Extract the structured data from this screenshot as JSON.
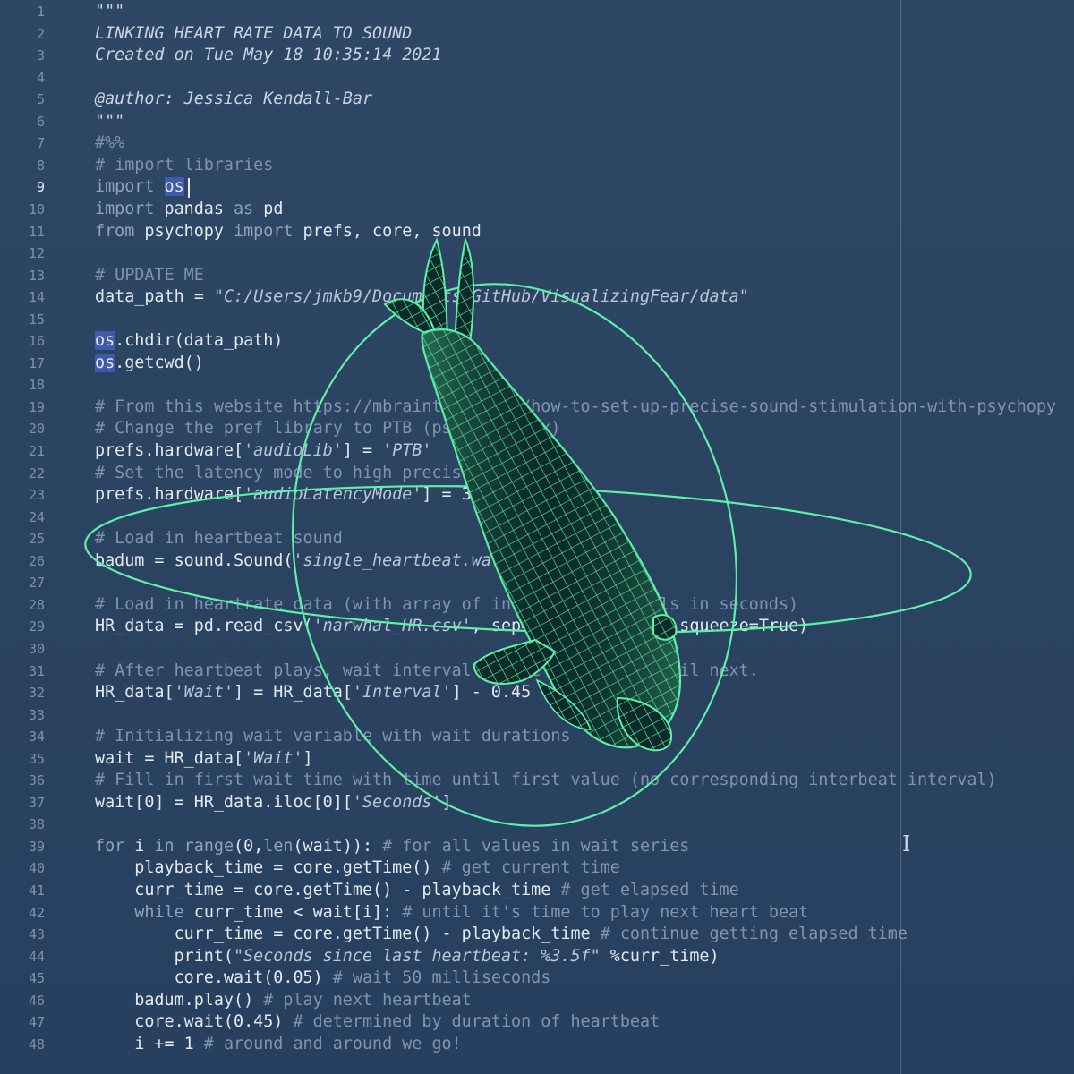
{
  "editor": {
    "active_line": 9,
    "colors": {
      "background": "#2b4461",
      "code_text": "#e3e9f1",
      "comment_text": "#8094ae",
      "selection_highlight": "#506ee6",
      "overlay_accent": "#5ef0a8"
    },
    "lines": [
      {
        "n": "1",
        "tokens": [
          {
            "t": "\"\"\"",
            "k": "d"
          }
        ]
      },
      {
        "n": "2",
        "tokens": [
          {
            "t": "LINKING HEART RATE DATA TO SOUND",
            "k": "d"
          }
        ]
      },
      {
        "n": "3",
        "tokens": [
          {
            "t": "Created on Tue May 18 10:35:14 2021",
            "k": "d"
          }
        ]
      },
      {
        "n": "4",
        "tokens": []
      },
      {
        "n": "5",
        "tokens": [
          {
            "t": "@author: Jessica Kendall-Bar",
            "k": "d"
          }
        ]
      },
      {
        "n": "6",
        "tokens": [
          {
            "t": "\"\"\"",
            "k": "d"
          }
        ]
      },
      {
        "n": "7",
        "tokens": [
          {
            "t": "#%%",
            "k": "c"
          }
        ]
      },
      {
        "n": "8",
        "tokens": [
          {
            "t": "# import libraries",
            "k": "c"
          }
        ]
      },
      {
        "n": "9",
        "tokens": [
          {
            "t": "import",
            "k": "k"
          },
          {
            "t": " "
          },
          {
            "t": "os",
            "k": "h"
          }
        ]
      },
      {
        "n": "10",
        "tokens": [
          {
            "t": "import",
            "k": "k"
          },
          {
            "t": " pandas "
          },
          {
            "t": "as",
            "k": "k"
          },
          {
            "t": " pd"
          }
        ]
      },
      {
        "n": "11",
        "tokens": [
          {
            "t": "from",
            "k": "k"
          },
          {
            "t": " psychopy "
          },
          {
            "t": "import",
            "k": "k"
          },
          {
            "t": " prefs, core, sound"
          }
        ]
      },
      {
        "n": "12",
        "tokens": []
      },
      {
        "n": "13",
        "tokens": [
          {
            "t": "# UPDATE ME",
            "k": "c"
          }
        ]
      },
      {
        "n": "14",
        "tokens": [
          {
            "t": "data_path = "
          },
          {
            "t": "\"C:/Users/jmkb9/Documents/GitHub/VisualizingFear/data\"",
            "k": "s"
          }
        ]
      },
      {
        "n": "15",
        "tokens": []
      },
      {
        "n": "16",
        "tokens": [
          {
            "t": "os",
            "k": "h"
          },
          {
            "t": ".chdir(data_path)"
          }
        ]
      },
      {
        "n": "17",
        "tokens": [
          {
            "t": "os",
            "k": "h"
          },
          {
            "t": ".getcwd()"
          }
        ]
      },
      {
        "n": "18",
        "tokens": []
      },
      {
        "n": "19",
        "tokens": [
          {
            "t": "# From this website ",
            "k": "c"
          },
          {
            "t": "https://mbraintrain.com/how-to-set-up-precise-sound-stimulation-with-psychopy",
            "k": "cu"
          }
        ]
      },
      {
        "n": "20",
        "tokens": [
          {
            "t": "# Change the pref library to PTB (psychtoolbox)",
            "k": "c"
          }
        ]
      },
      {
        "n": "21",
        "tokens": [
          {
            "t": "prefs.hardware["
          },
          {
            "t": "'audioLib'",
            "k": "s"
          },
          {
            "t": "] = "
          },
          {
            "t": "'PTB'",
            "k": "s"
          }
        ]
      },
      {
        "n": "22",
        "tokens": [
          {
            "t": "# Set the latency mode to high precision",
            "k": "c"
          }
        ]
      },
      {
        "n": "23",
        "tokens": [
          {
            "t": "prefs.hardware["
          },
          {
            "t": "'audioLatencyMode'",
            "k": "s"
          },
          {
            "t": "] = 3"
          }
        ]
      },
      {
        "n": "24",
        "tokens": []
      },
      {
        "n": "25",
        "tokens": [
          {
            "t": "# Load in heartbeat sound",
            "k": "c"
          }
        ]
      },
      {
        "n": "26",
        "tokens": [
          {
            "t": "badum = sound.Sound("
          },
          {
            "t": "'single_heartbeat.wav'",
            "k": "s"
          },
          {
            "t": ")"
          }
        ]
      },
      {
        "n": "27",
        "tokens": []
      },
      {
        "n": "28",
        "tokens": [
          {
            "t": "# Load in heartrate data (with array of interbeat intervals in seconds)",
            "k": "c"
          }
        ]
      },
      {
        "n": "29",
        "tokens": [
          {
            "t": "HR_data = pd.read_csv("
          },
          {
            "t": "'narwhal_HR.csv'",
            "k": "s"
          },
          {
            "t": ", sep="
          },
          {
            "t": "','",
            "k": "s"
          },
          {
            "t": ", header=0, squeeze=True)"
          }
        ]
      },
      {
        "n": "30",
        "tokens": []
      },
      {
        "n": "31",
        "tokens": [
          {
            "t": "# After heartbeat plays, wait interval before heartbeat until next.",
            "k": "c"
          }
        ]
      },
      {
        "n": "32",
        "tokens": [
          {
            "t": "HR_data["
          },
          {
            "t": "'Wait'",
            "k": "s"
          },
          {
            "t": "] = HR_data["
          },
          {
            "t": "'Interval'",
            "k": "s"
          },
          {
            "t": "] - 0.45"
          }
        ]
      },
      {
        "n": "33",
        "tokens": []
      },
      {
        "n": "34",
        "tokens": [
          {
            "t": "# Initializing wait variable with wait durations",
            "k": "c"
          }
        ]
      },
      {
        "n": "35",
        "tokens": [
          {
            "t": "wait = HR_data["
          },
          {
            "t": "'Wait'",
            "k": "s"
          },
          {
            "t": "]"
          }
        ]
      },
      {
        "n": "36",
        "tokens": [
          {
            "t": "# Fill in first wait time with time until first value (no corresponding interbeat interval)",
            "k": "c"
          }
        ]
      },
      {
        "n": "37",
        "tokens": [
          {
            "t": "wait[0] = HR_data.iloc[0]["
          },
          {
            "t": "'Seconds'",
            "k": "s"
          },
          {
            "t": "]"
          }
        ]
      },
      {
        "n": "38",
        "tokens": []
      },
      {
        "n": "39",
        "tokens": [
          {
            "t": "for",
            "k": "k"
          },
          {
            "t": " i "
          },
          {
            "t": "in",
            "k": "k"
          },
          {
            "t": " "
          },
          {
            "t": "range",
            "k": "k"
          },
          {
            "t": "(0,"
          },
          {
            "t": "len",
            "k": "k"
          },
          {
            "t": "(wait)): "
          },
          {
            "t": "# for all values in wait series",
            "k": "c"
          }
        ]
      },
      {
        "n": "40",
        "tokens": [
          {
            "t": "    playback_time = core.getTime() "
          },
          {
            "t": "# get current time",
            "k": "c"
          }
        ]
      },
      {
        "n": "41",
        "tokens": [
          {
            "t": "    curr_time = core.getTime() - playback_time "
          },
          {
            "t": "# get elapsed time",
            "k": "c"
          }
        ]
      },
      {
        "n": "42",
        "tokens": [
          {
            "t": "    "
          },
          {
            "t": "while",
            "k": "k"
          },
          {
            "t": " curr_time < wait[i]: "
          },
          {
            "t": "# until it's time to play next heart beat",
            "k": "c"
          }
        ]
      },
      {
        "n": "43",
        "tokens": [
          {
            "t": "        curr_time = core.getTime() - playback_time "
          },
          {
            "t": "# continue getting elapsed time",
            "k": "c"
          }
        ]
      },
      {
        "n": "44",
        "tokens": [
          {
            "t": "        print("
          },
          {
            "t": "\"Seconds since last heartbeat: %3.5f\"",
            "k": "s"
          },
          {
            "t": " %curr_time)"
          }
        ]
      },
      {
        "n": "45",
        "tokens": [
          {
            "t": "        core.wait(0.05) "
          },
          {
            "t": "# wait 50 milliseconds",
            "k": "c"
          }
        ]
      },
      {
        "n": "46",
        "tokens": [
          {
            "t": "    badum.play() "
          },
          {
            "t": "# play next heartbeat",
            "k": "c"
          }
        ]
      },
      {
        "n": "47",
        "tokens": [
          {
            "t": "    core.wait(0.45) "
          },
          {
            "t": "# determined by duration of heartbeat",
            "k": "c"
          }
        ]
      },
      {
        "n": "48",
        "tokens": [
          {
            "t": "    i += 1 "
          },
          {
            "t": "# around and around we go!",
            "k": "c"
          }
        ]
      }
    ]
  },
  "overlay": {
    "figure_icon": "wireframe-seal-icon",
    "orbit_icon": "orbit-ring-icon",
    "cursor_icon": "i-beam-cursor-icon"
  }
}
